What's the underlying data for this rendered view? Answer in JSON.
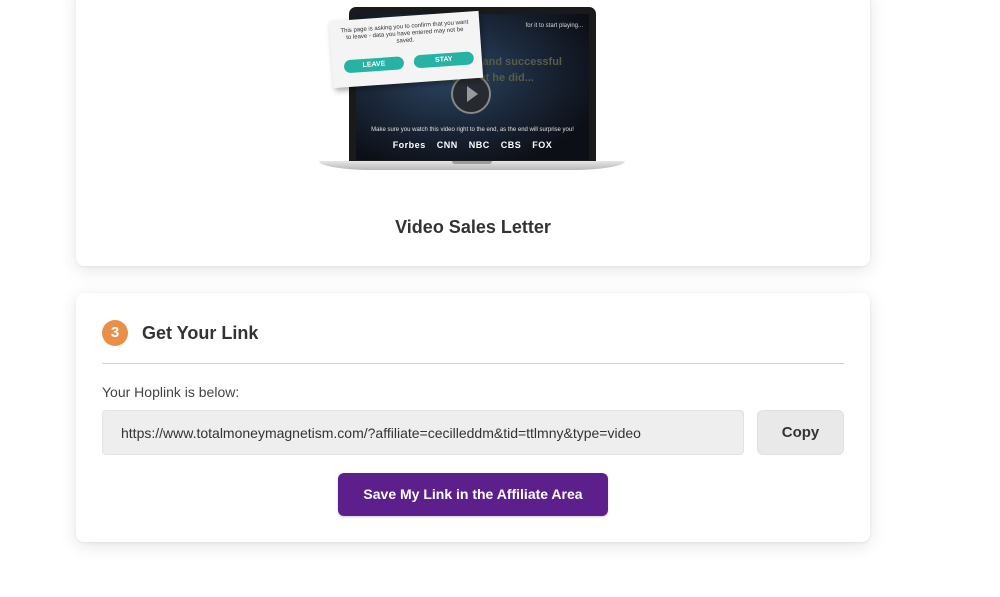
{
  "vsl_card": {
    "caption": "Video Sales Letter",
    "preview": {
      "dialog_message": "This page is asking you to confirm that you want to leave - data you have entered may not be saved.",
      "leave_label": "LEAVE",
      "stay_label": "STAY",
      "screen_top_text": "for it to start playing...",
      "blurred_text": "...ey to it ...athy and successful ...atter what he did...",
      "video_note": "Make sure you watch this video right to the end, as the end will surprise you!",
      "logos": [
        "Forbes",
        "CNN",
        "NBC",
        "CBS",
        "FOX"
      ]
    }
  },
  "link_card": {
    "step_number": "3",
    "title": "Get Your Link",
    "hoplink_label": "Your Hoplink is below:",
    "hoplink_value": "https://www.totalmoneymagnetism.com/?affiliate=cecilleddm&tid=ttlmny&type=video",
    "copy_label": "Copy",
    "save_label": "Save My Link in the Affiliate Area"
  },
  "colors": {
    "step_badge": "#e8904a",
    "save_button": "#5c1f8c",
    "dialog_button": "#26b3a4"
  }
}
